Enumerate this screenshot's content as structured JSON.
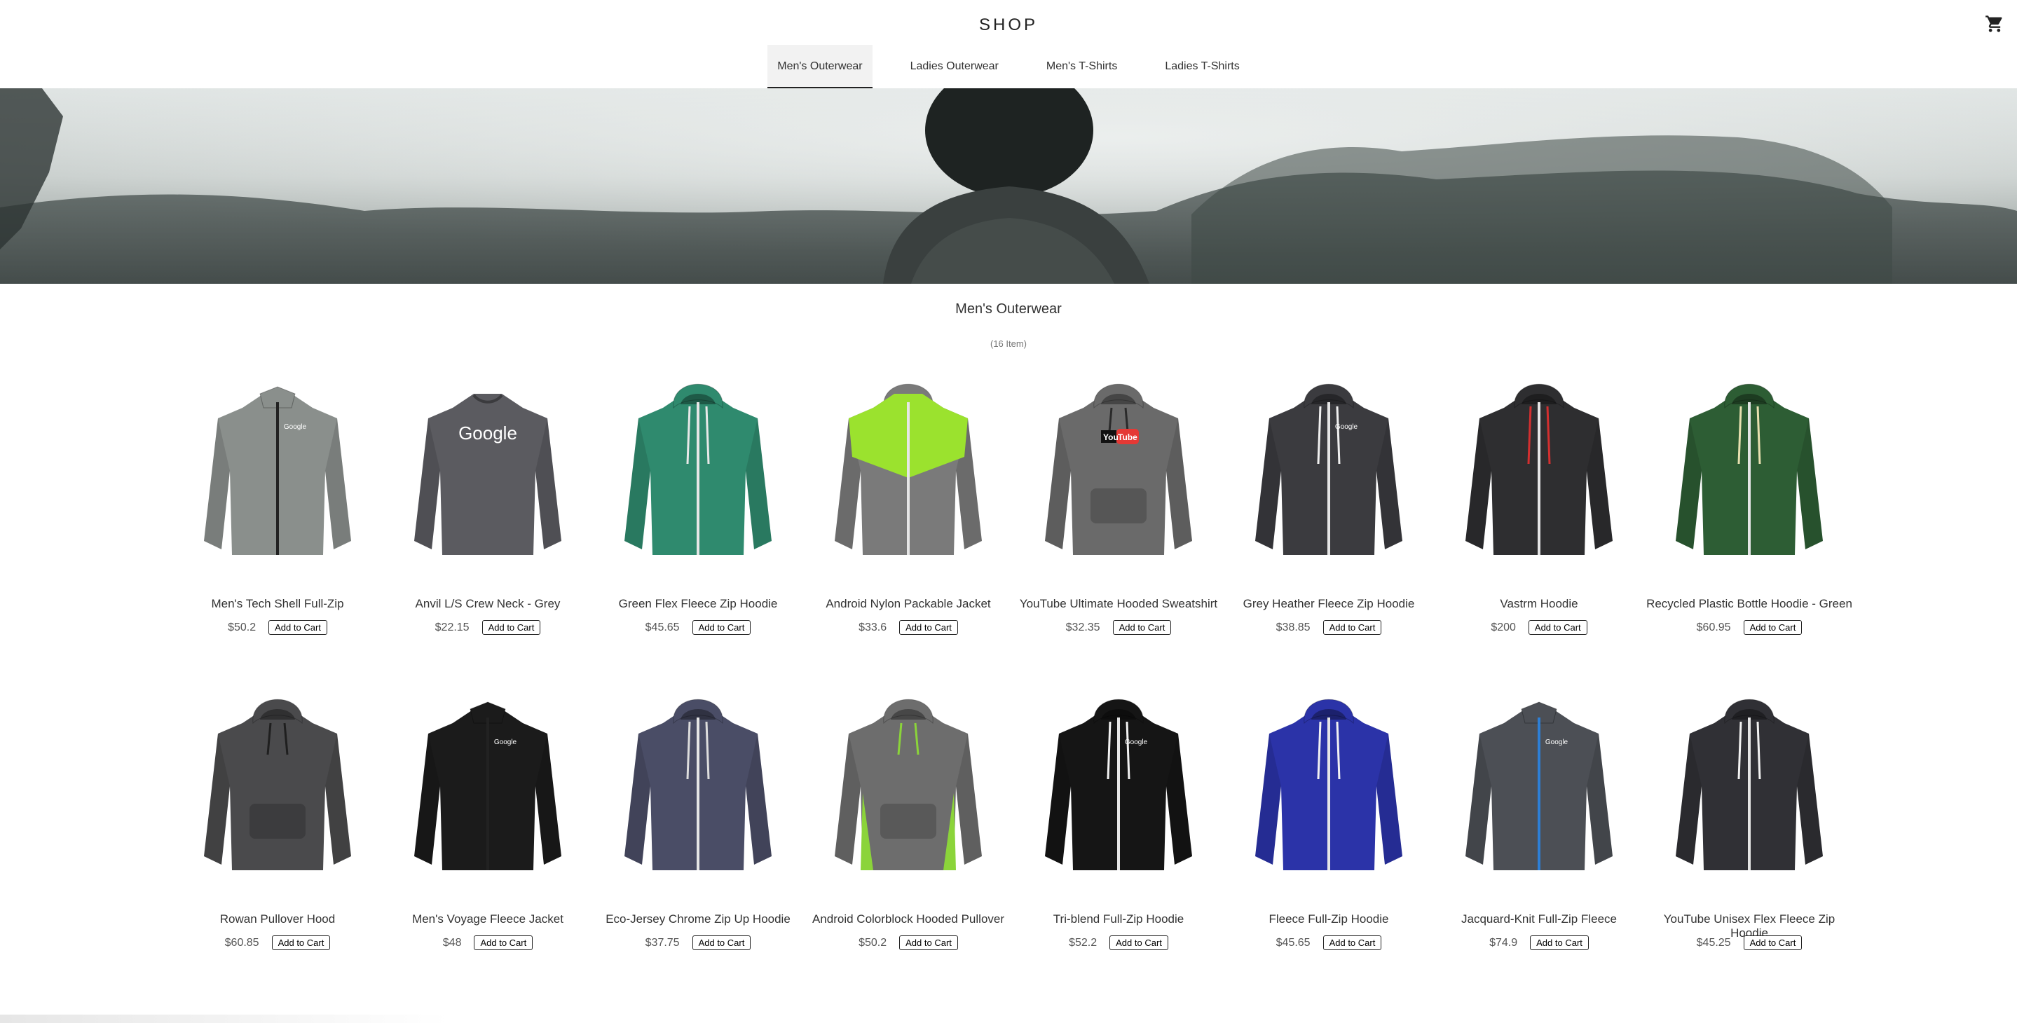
{
  "app": {
    "logo": "SHOP"
  },
  "nav": {
    "tabs": [
      {
        "label": "Men's Outerwear",
        "active": true
      },
      {
        "label": "Ladies Outerwear",
        "active": false
      },
      {
        "label": "Men's T-Shirts",
        "active": false
      },
      {
        "label": "Ladies T-Shirts",
        "active": false
      }
    ],
    "cart_icon": "shopping-cart-icon"
  },
  "category": {
    "title": "Men's Outerwear",
    "count": "(16 Item)"
  },
  "add_to_cart_label": "Add to Cart",
  "products": [
    {
      "name": "Men's Tech Shell Full-Zip",
      "price": "$50.2",
      "color": "#8a8f8c",
      "style": "jacket",
      "trim": "#2f4f3a",
      "logo": "Google"
    },
    {
      "name": "Anvil L/S Crew Neck - Grey",
      "price": "$22.15",
      "color": "#5b5b60",
      "style": "crew",
      "trim": "#5b5b60",
      "logo": "Google"
    },
    {
      "name": "Green Flex Fleece Zip Hoodie",
      "price": "$45.65",
      "color": "#2f8a6e",
      "style": "hoodie",
      "trim": "#e8e8e8",
      "logo": ""
    },
    {
      "name": "Android Nylon Packable Jacket",
      "price": "$33.6",
      "color": "#7a7a7a",
      "style": "windbreaker",
      "trim": "#9be22e",
      "logo": ""
    },
    {
      "name": "YouTube Ultimate Hooded Sweatshirt",
      "price": "$32.35",
      "color": "#6a6a6a",
      "style": "pullover",
      "trim": "#2a2a2a",
      "logo": "YouTube"
    },
    {
      "name": "Grey Heather Fleece Zip Hoodie",
      "price": "$38.85",
      "color": "#3b3b3f",
      "style": "hoodie",
      "trim": "#f0f0f0",
      "logo": "Google"
    },
    {
      "name": "Vastrm Hoodie",
      "price": "$200",
      "color": "#2e2e30",
      "style": "hoodie",
      "trim": "#d32f2f",
      "logo": ""
    },
    {
      "name": "Recycled Plastic Bottle Hoodie - Green",
      "price": "$60.95",
      "color": "#2d5d34",
      "style": "hoodie",
      "trim": "#e8e0b0",
      "logo": ""
    },
    {
      "name": "Rowan Pullover Hood",
      "price": "$60.85",
      "color": "#4a4a4c",
      "style": "pullover",
      "trim": "#1f1f1f",
      "logo": ""
    },
    {
      "name": "Men's Voyage Fleece Jacket",
      "price": "$48",
      "color": "#1b1b1b",
      "style": "jacket",
      "trim": "#111111",
      "logo": "Google"
    },
    {
      "name": "Eco-Jersey Chrome Zip Up Hoodie",
      "price": "$37.75",
      "color": "#4a4d66",
      "style": "hoodie",
      "trim": "#dddddd",
      "logo": ""
    },
    {
      "name": "Android Colorblock Hooded Pullover",
      "price": "$50.2",
      "color": "#6d6d6d",
      "style": "pullover",
      "trim": "#8bd43a",
      "logo": ""
    },
    {
      "name": "Tri-blend Full-Zip Hoodie",
      "price": "$52.2",
      "color": "#151515",
      "style": "hoodie",
      "trim": "#f2f2f2",
      "logo": "Google"
    },
    {
      "name": "Fleece Full-Zip Hoodie",
      "price": "$45.65",
      "color": "#2b33a8",
      "style": "hoodie",
      "trim": "#f2f2f2",
      "logo": ""
    },
    {
      "name": "Jacquard-Knit Full-Zip Fleece",
      "price": "$74.9",
      "color": "#4c4f55",
      "style": "jacket",
      "trim": "#2d7fd6",
      "logo": "Google"
    },
    {
      "name": "YouTube Unisex Flex Fleece Zip Hoodie",
      "price": "$45.25",
      "color": "#303035",
      "style": "hoodie",
      "trim": "#f2f2f2",
      "logo": ""
    }
  ]
}
